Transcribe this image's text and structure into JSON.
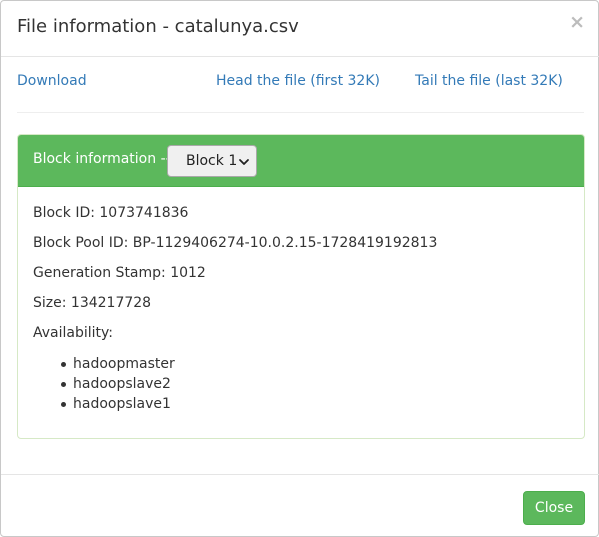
{
  "dialog": {
    "title": "File information - catalunya.csv",
    "close_glyph": "×"
  },
  "links": {
    "download": "Download",
    "head": "Head the file (first 32K)",
    "tail": "Tail the file (last 32K)"
  },
  "block_panel": {
    "heading_label": "Block information --",
    "selected_block": "Block 1",
    "block_id": "Block ID: 1073741836",
    "block_pool_id": "Block Pool ID: BP-1129406274-10.0.2.15-1728419192813",
    "generation_stamp": "Generation Stamp: 1012",
    "size": "Size: 134217728",
    "availability_label": "Availability:",
    "availability": [
      "hadoopmaster",
      "hadoopslave2",
      "hadoopslave1"
    ]
  },
  "footer": {
    "close_label": "Close"
  },
  "colors": {
    "primary_green": "#5cb85c",
    "link_blue": "#337ab7"
  },
  "icons": {
    "close": "close-icon",
    "select_arrow": "chevron-down-icon"
  }
}
